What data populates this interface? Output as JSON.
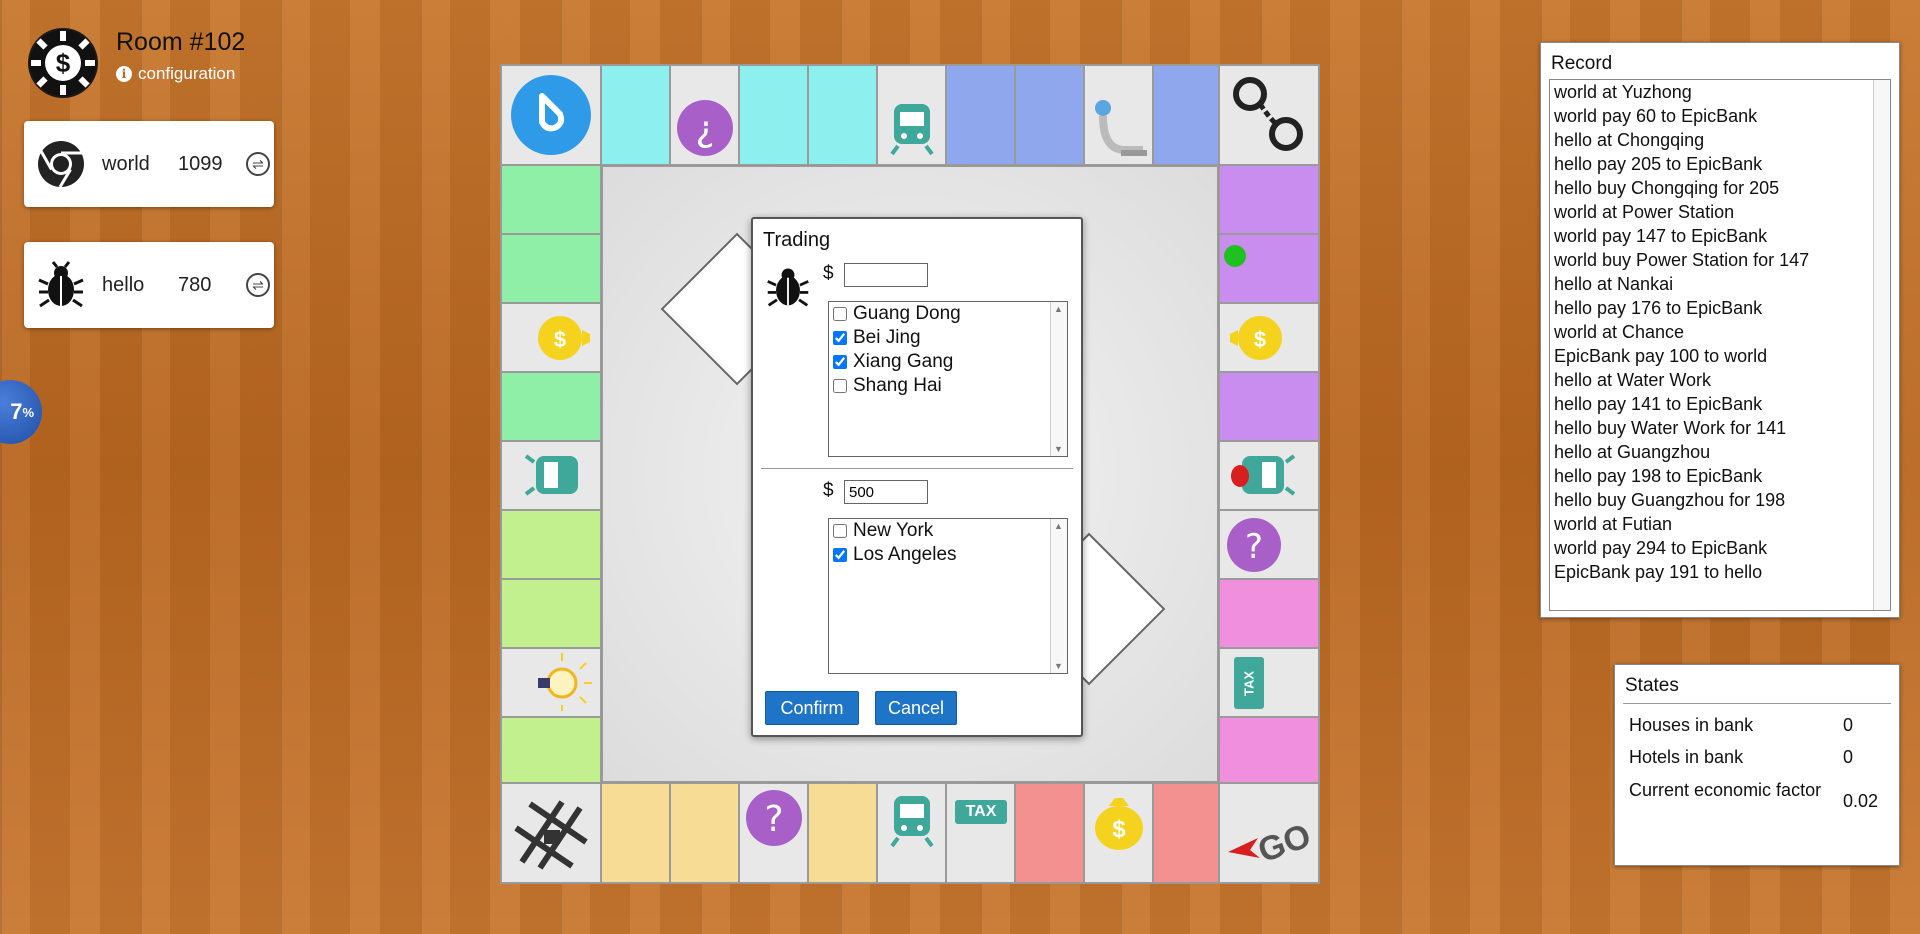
{
  "header": {
    "room_title": "Room #102",
    "config_label": "configuration"
  },
  "players": [
    {
      "name": "world",
      "money": "1099",
      "avatar_icon": "chrome-icon"
    },
    {
      "name": "hello",
      "money": "780",
      "avatar_icon": "bug-icon"
    }
  ],
  "progress": {
    "value": "7",
    "unit": "%"
  },
  "board": {
    "tax_label": "TAX",
    "go_label": "GO",
    "side_tax_label": "TAX"
  },
  "trading": {
    "title": "Trading",
    "currency": "$",
    "my_money": "",
    "my_properties": [
      {
        "name": "Guang Dong",
        "checked": false
      },
      {
        "name": "Bei Jing",
        "checked": true
      },
      {
        "name": "Xiang Gang",
        "checked": true
      },
      {
        "name": "Shang Hai",
        "checked": false
      }
    ],
    "their_money": "500",
    "their_properties": [
      {
        "name": "New York",
        "checked": false
      },
      {
        "name": "Los Angeles",
        "checked": true
      }
    ],
    "confirm_label": "Confirm",
    "cancel_label": "Cancel"
  },
  "record": {
    "title": "Record",
    "lines": [
      "world at Yuzhong",
      "world pay 60 to EpicBank",
      "hello at Chongqing",
      "hello pay 205 to EpicBank",
      "hello buy Chongqing for 205",
      "world at Power Station",
      "world pay 147 to EpicBank",
      "world buy Power Station for 147",
      "hello at Nankai",
      "hello pay 176 to EpicBank",
      "world at Chance",
      "EpicBank pay 100 to world",
      "hello at Water Work",
      "hello pay 141 to EpicBank",
      "hello buy Water Work for 141",
      "hello at Guangzhou",
      "hello pay 198 to EpicBank",
      "hello buy Guangzhou for 198",
      "world at Futian",
      "world pay 294 to EpicBank",
      "EpicBank pay 191 to hello"
    ]
  },
  "states": {
    "title": "States",
    "rows": [
      {
        "label": "Houses in bank",
        "value": "0"
      },
      {
        "label": "Hotels in bank",
        "value": "0"
      },
      {
        "label": "Current economic factor",
        "value": "0.02"
      }
    ]
  },
  "colors": {
    "cyan": "#8ef0ee",
    "blue": "#8fa7ec",
    "purple": "#c98df0",
    "pink": "#f08fdd",
    "green": "#8fefa6",
    "lime": "#c3f08f",
    "yellow": "#f6dc94",
    "red": "#f39090",
    "button": "#1e74c6"
  }
}
